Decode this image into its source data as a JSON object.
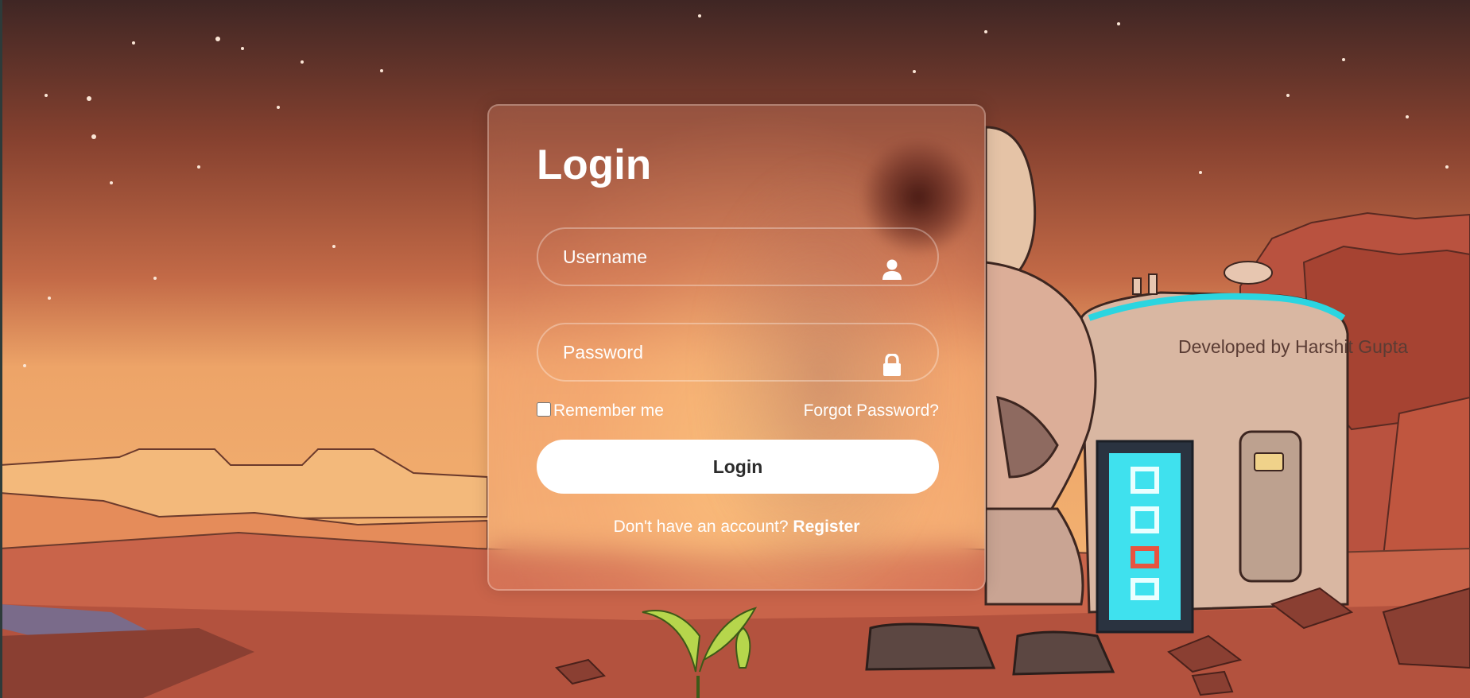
{
  "form": {
    "title": "Login",
    "username_placeholder": "Username",
    "password_placeholder": "Password",
    "remember_label": "Remember me",
    "forgot_label": "Forgot Password?",
    "login_button": "Login",
    "register_prompt": "Don't have an account?",
    "register_link": "Register"
  },
  "footer": {
    "credit": "Developed by Harshit Gupta"
  },
  "icons": {
    "username": "user-icon",
    "password": "lock-icon"
  },
  "colors": {
    "card_border": "#ffffff",
    "button_bg": "#ffffff",
    "button_text": "#2b2b2b",
    "text": "#ffffff"
  }
}
